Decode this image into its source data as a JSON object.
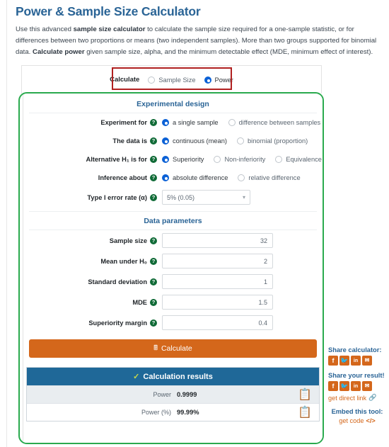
{
  "header": {
    "title": "Power & Sample Size Calculator",
    "intro_1": "Use this advanced ",
    "intro_b1": "sample size calculator",
    "intro_2": " to calculate the sample size required for a one-sample statistic, or for differences between two proportions or means (two independent samples). More than two groups supported for binomial data. ",
    "intro_b2": "Calculate power",
    "intro_3": " given sample size, alpha, and the minimum detectable effect (MDE, minimum effect of interest)."
  },
  "calculate_mode": {
    "label": "Calculate",
    "options": [
      {
        "label": "Sample Size",
        "selected": false
      },
      {
        "label": "Power",
        "selected": true
      }
    ]
  },
  "experimental_design": {
    "section_title": "Experimental design",
    "rows": [
      {
        "label": "Experiment for",
        "help": "?",
        "options": [
          {
            "label": "a single sample",
            "selected": true
          },
          {
            "label": "difference between samples",
            "selected": false
          }
        ]
      },
      {
        "label": "The data is",
        "help": "?",
        "options": [
          {
            "label": "continuous (mean)",
            "selected": true
          },
          {
            "label": "binomial (proportion)",
            "selected": false
          }
        ]
      },
      {
        "label_html": "Alternative H₁ is for",
        "help": "?",
        "options": [
          {
            "label": "Superiority",
            "selected": true
          },
          {
            "label": "Non-inferiority",
            "selected": false
          },
          {
            "label": "Equivalence",
            "selected": false
          }
        ]
      },
      {
        "label": "Inference about",
        "help": "?",
        "options": [
          {
            "label": "absolute difference",
            "selected": true
          },
          {
            "label": "relative difference",
            "selected": false
          }
        ]
      }
    ],
    "alpha": {
      "label": "Type I error rate (α)",
      "help": "?",
      "value": "5% (0.05)",
      "chevron": "chevron-down-icon"
    }
  },
  "data_parameters": {
    "section_title": "Data parameters",
    "fields": [
      {
        "label": "Sample size",
        "help": "?",
        "value": "32"
      },
      {
        "label_html": "Mean under H₀",
        "help": "?",
        "value": "2"
      },
      {
        "label": "Standard deviation",
        "help": "?",
        "value": "1"
      },
      {
        "label": "MDE",
        "help": "?",
        "value": "1.5"
      },
      {
        "label": "Superiority margin",
        "help": "?",
        "value": "0.4"
      }
    ]
  },
  "calculate_button": {
    "label": "Calculate",
    "icon": "calculator-icon"
  },
  "results": {
    "title": "Calculation results",
    "check_icon": "check-icon",
    "rows": [
      {
        "label": "Power",
        "value": "0.9999",
        "copy_icon": "clipboard-icon"
      },
      {
        "label": "Power (%)",
        "value": "99.99%",
        "copy_icon": "clipboard-icon"
      }
    ]
  },
  "share_rail": {
    "share_calculator_title": "Share calculator:",
    "share_result_title": "Share your result!",
    "direct_link": "get direct link",
    "embed_title": "Embed this tool:",
    "embed_link": "get code",
    "embed_code_icon": "</>",
    "link_icon": "link-icon",
    "social": [
      {
        "name": "facebook-icon",
        "glyph": "f"
      },
      {
        "name": "twitter-icon",
        "glyph": "🐦"
      },
      {
        "name": "linkedin-icon",
        "glyph": "in"
      },
      {
        "name": "email-icon",
        "glyph": "✉"
      }
    ]
  },
  "colors": {
    "title_blue": "#2a6496",
    "green_border": "#2aaa4e",
    "red_highlight": "#b02020",
    "orange": "#d4671b",
    "results_blue": "#1f6898",
    "radio_blue": "#0b61d6",
    "help_green": "#0f6a36"
  }
}
